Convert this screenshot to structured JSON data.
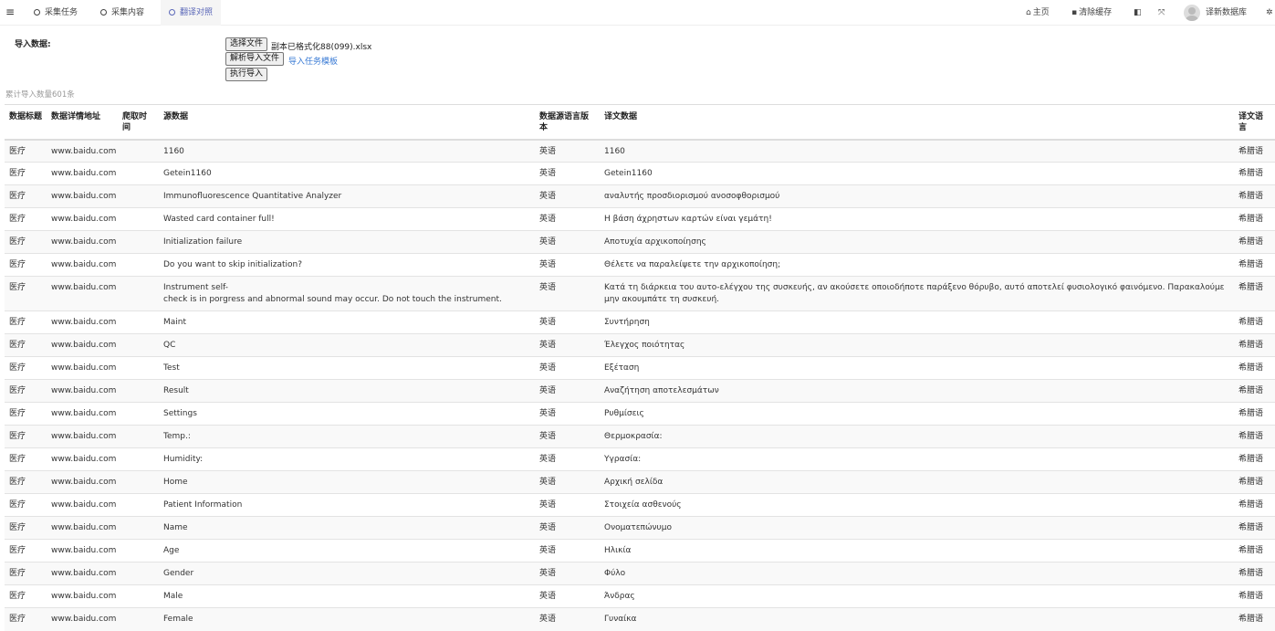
{
  "nav": {
    "menu_icon": "hamburger-icon",
    "tabs": [
      {
        "label": "采集任务",
        "active": false
      },
      {
        "label": "采集内容",
        "active": false
      },
      {
        "label": "翻译对照",
        "active": true
      }
    ],
    "right": {
      "home_label": "主页",
      "home_icon": "home-icon",
      "clear_cache_label": "清除缓存",
      "clear_cache_icon": "trash-icon",
      "theme_icon": "theme-toggle-icon",
      "fullscreen_icon": "fullscreen-icon",
      "username": "译新数据库",
      "settings_icon": "gears-icon"
    }
  },
  "import": {
    "label": "导入数据:",
    "choose_file_button": "选择文件",
    "file_name": "副本已格式化88(099).xlsx",
    "parse_button": "解析导入文件",
    "template_link": "导入任务模板",
    "execute_button": "执行导入",
    "count_text": "累计导入数量601条"
  },
  "table": {
    "headers": {
      "title": "数据标题",
      "url": "数据详情地址",
      "time": "爬取时间",
      "source": "源数据",
      "src_lang": "数据源语言版本",
      "translation": "译文数据",
      "target_lang": "译文语言"
    },
    "rows": [
      {
        "title": "医疗",
        "url": "www.baidu.com",
        "time": "",
        "source": "1160",
        "src_lang": "英语",
        "translation": "1160",
        "target_lang": "希腊语"
      },
      {
        "title": "医疗",
        "url": "www.baidu.com",
        "time": "",
        "source": "Getein1160",
        "src_lang": "英语",
        "translation": "Getein1160",
        "target_lang": "希腊语"
      },
      {
        "title": "医疗",
        "url": "www.baidu.com",
        "time": "",
        "source": "Immunofluorescence Quantitative Analyzer",
        "src_lang": "英语",
        "translation": "αναλυτής προσδιορισμού ανοσοφθορισμού",
        "target_lang": "希腊语"
      },
      {
        "title": "医疗",
        "url": "www.baidu.com",
        "time": "",
        "source": "Wasted card container full!",
        "src_lang": "英语",
        "translation": "Η βάση άχρηστων καρτών είναι γεμάτη!",
        "target_lang": "希腊语"
      },
      {
        "title": "医疗",
        "url": "www.baidu.com",
        "time": "",
        "source": "Initialization failure",
        "src_lang": "英语",
        "translation": "Αποτυχία αρχικοποίησης",
        "target_lang": "希腊语"
      },
      {
        "title": "医疗",
        "url": "www.baidu.com",
        "time": "",
        "source": "Do you want to skip initialization?",
        "src_lang": "英语",
        "translation": "Θέλετε να παραλείψετε την αρχικοποίηση;",
        "target_lang": "希腊语"
      },
      {
        "title": "医疗",
        "url": "www.baidu.com",
        "time": "",
        "source": "Instrument self-\ncheck is in porgress and abnormal sound may occur. Do not touch the instrument.",
        "src_lang": "英语",
        "translation": "Κατά τη διάρκεια του αυτο-ελέγχου της συσκευής, αν ακούσετε οποιοδήποτε παράξενο θόρυβο, αυτό αποτελεί φυσιολογικό φαινόμενο. Παρακαλούμε μην ακουμπάτε τη συσκευή.",
        "target_lang": "希腊语",
        "tall": true
      },
      {
        "title": "医疗",
        "url": "www.baidu.com",
        "time": "",
        "source": "Maint",
        "src_lang": "英语",
        "translation": "Συντήρηση",
        "target_lang": "希腊语"
      },
      {
        "title": "医疗",
        "url": "www.baidu.com",
        "time": "",
        "source": "QC",
        "src_lang": "英语",
        "translation": "Έλεγχος ποιότητας",
        "target_lang": "希腊语"
      },
      {
        "title": "医疗",
        "url": "www.baidu.com",
        "time": "",
        "source": "Test",
        "src_lang": "英语",
        "translation": "Εξέταση",
        "target_lang": "希腊语"
      },
      {
        "title": "医疗",
        "url": "www.baidu.com",
        "time": "",
        "source": "Result",
        "src_lang": "英语",
        "translation": "Αναζήτηση αποτελεσμάτων",
        "target_lang": "希腊语"
      },
      {
        "title": "医疗",
        "url": "www.baidu.com",
        "time": "",
        "source": "Settings",
        "src_lang": "英语",
        "translation": "Ρυθμίσεις",
        "target_lang": "希腊语"
      },
      {
        "title": "医疗",
        "url": "www.baidu.com",
        "time": "",
        "source": "Temp.:",
        "src_lang": "英语",
        "translation": "Θερμοκρασία:",
        "target_lang": "希腊语"
      },
      {
        "title": "医疗",
        "url": "www.baidu.com",
        "time": "",
        "source": "Humidity:",
        "src_lang": "英语",
        "translation": "Υγρασία:",
        "target_lang": "希腊语"
      },
      {
        "title": "医疗",
        "url": "www.baidu.com",
        "time": "",
        "source": "Home",
        "src_lang": "英语",
        "translation": "Αρχική σελίδα",
        "target_lang": "希腊语"
      },
      {
        "title": "医疗",
        "url": "www.baidu.com",
        "time": "",
        "source": "Patient Information",
        "src_lang": "英语",
        "translation": "Στοιχεία ασθενούς",
        "target_lang": "希腊语"
      },
      {
        "title": "医疗",
        "url": "www.baidu.com",
        "time": "",
        "source": "Name",
        "src_lang": "英语",
        "translation": "Ονοματεπώνυμο",
        "target_lang": "希腊语"
      },
      {
        "title": "医疗",
        "url": "www.baidu.com",
        "time": "",
        "source": "Age",
        "src_lang": "英语",
        "translation": "Ηλικία",
        "target_lang": "希腊语"
      },
      {
        "title": "医疗",
        "url": "www.baidu.com",
        "time": "",
        "source": "Gender",
        "src_lang": "英语",
        "translation": "Φύλο",
        "target_lang": "希腊语"
      },
      {
        "title": "医疗",
        "url": "www.baidu.com",
        "time": "",
        "source": "Male",
        "src_lang": "英语",
        "translation": "Άνδρας",
        "target_lang": "希腊语"
      },
      {
        "title": "医疗",
        "url": "www.baidu.com",
        "time": "",
        "source": "Female",
        "src_lang": "英语",
        "translation": "Γυναίκα",
        "target_lang": "希腊语"
      }
    ]
  }
}
